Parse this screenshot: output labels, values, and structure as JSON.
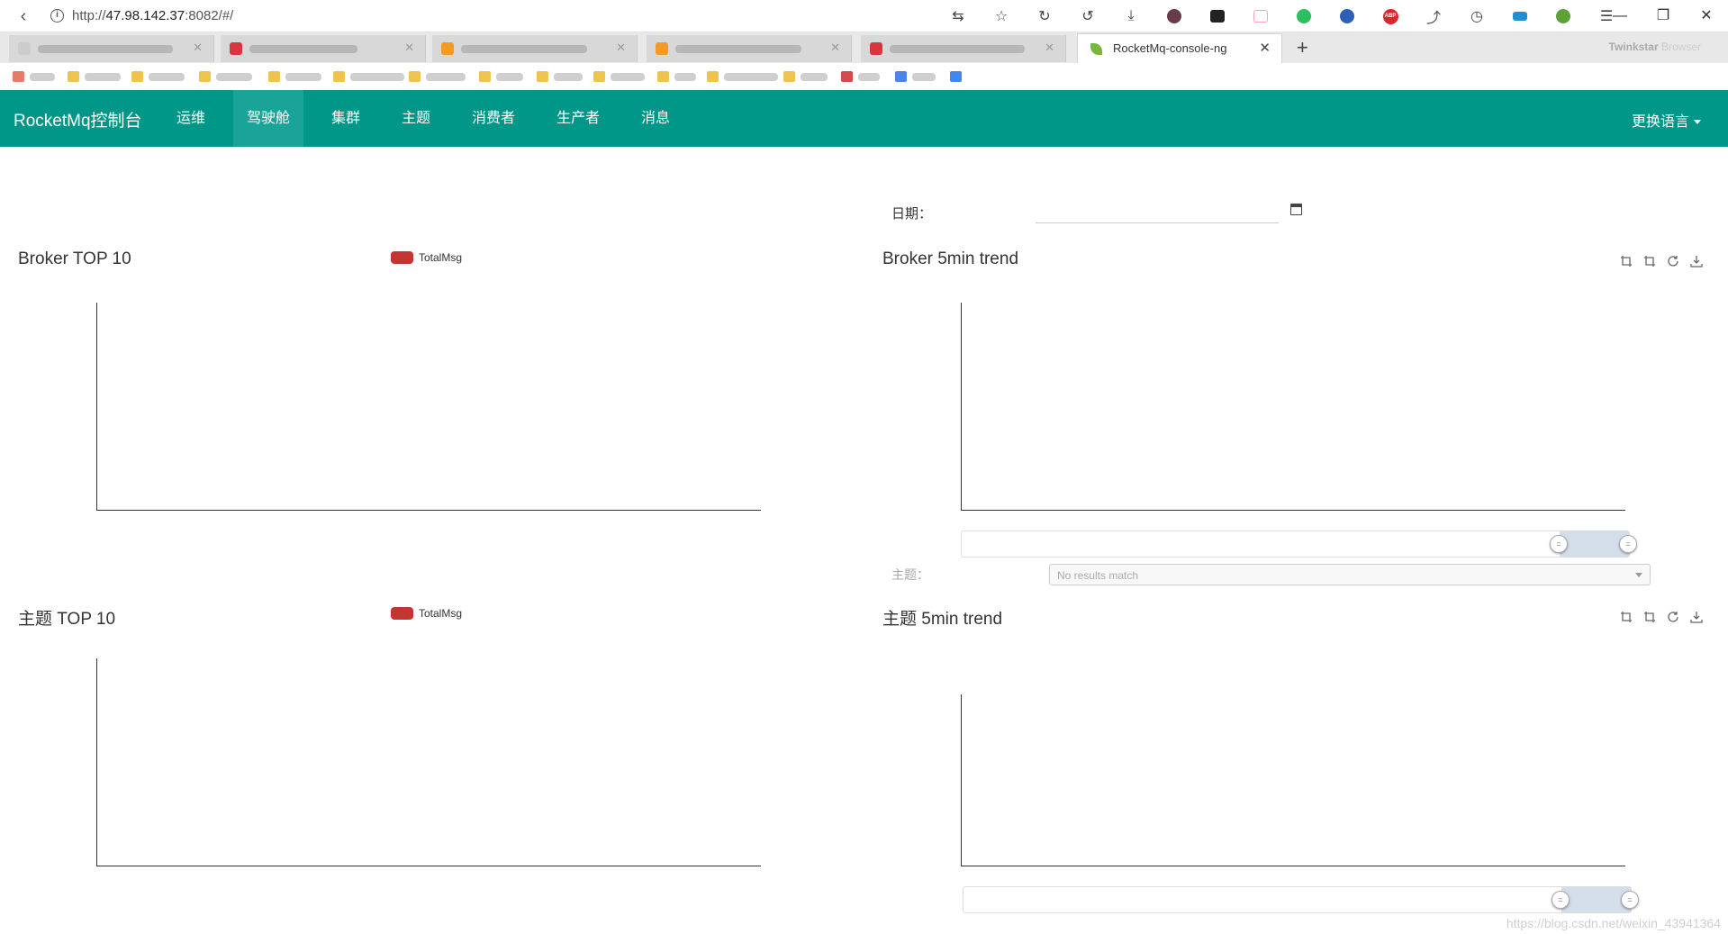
{
  "browser": {
    "url_prefix": "http://",
    "url_host": "47.98.142.37",
    "url_rest": ":8082/#/",
    "active_tab_title": "RocketMq-console-ng",
    "brand": "Twinkstar",
    "brand_suffix": "Browser",
    "icons": [
      "back-icon",
      "info-icon",
      "translate-icon",
      "star-icon",
      "sync-icon",
      "history-icon",
      "download-icon",
      "extension-icon",
      "new-tab-icon",
      "close-icon",
      "window-minimize-icon",
      "window-restore-icon",
      "window-close-icon",
      "menu-icon"
    ]
  },
  "navbar": {
    "brand": "RocketMq控制台",
    "items": [
      {
        "label": "运维"
      },
      {
        "label": "驾驶舱",
        "active": true
      },
      {
        "label": "集群"
      },
      {
        "label": "主题"
      },
      {
        "label": "消费者"
      },
      {
        "label": "生产者"
      },
      {
        "label": "消息"
      }
    ],
    "language": "更换语言",
    "color": "#009688",
    "active_color": "#1aa497"
  },
  "filter": {
    "date_label": "日期：",
    "date_value": ""
  },
  "panels": {
    "broker_top": {
      "title": "Broker TOP 10",
      "legend": "TotalMsg",
      "legend_color": "#c23531"
    },
    "broker_trend": {
      "title": "Broker 5min trend"
    },
    "topic_top": {
      "title": "主题 TOP 10",
      "legend": "TotalMsg",
      "legend_color": "#c23531"
    },
    "topic_trend": {
      "title": "主题 5min trend"
    },
    "topic_label": "主题：",
    "topic_placeholder": "No results match"
  },
  "watermark": "https://blog.csdn.net/weixin_43941364"
}
